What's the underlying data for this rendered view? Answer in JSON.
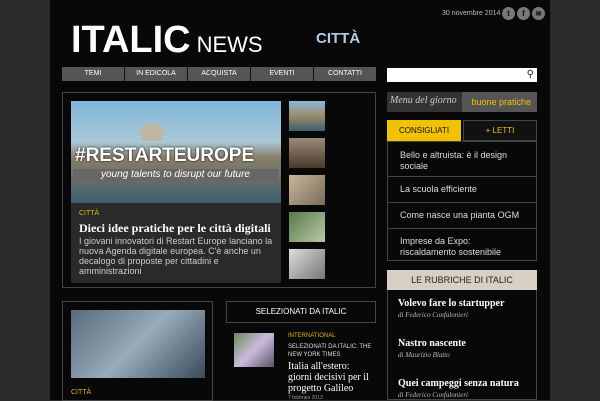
{
  "brand": {
    "main": "ITALIC",
    "sub": "NEWS",
    "section": "CITTÀ"
  },
  "header": {
    "date": "30 novembre 2014",
    "social": [
      "twitter-icon",
      "facebook-icon",
      "rss-icon"
    ]
  },
  "nav": [
    "TEMI",
    "IN EDICOLA",
    "ACQUISTA",
    "EVENTI",
    "CONTATTI"
  ],
  "search": {
    "placeholder": ""
  },
  "menu": {
    "label": "Menu del giorno",
    "selected": "buone pratiche"
  },
  "featured": {
    "overlay_title": "#RESTARTEUROPE",
    "overlay_sub": "young talents to disrupt our future",
    "category": "CITTÀ",
    "headline": "Dieci idee pratiche per le città digitali",
    "summary": "I giovani innovatori di Restart Europe lanciano la nuova Agenda digitale europea. C'è anche un decalogo di proposte per cittadini e amministrazioni"
  },
  "second": {
    "category": "CITTÀ"
  },
  "selected": {
    "header": "SELEZIONATI DA ITALIC",
    "category": "INTERNATIONAL",
    "source": "SELEZIONATI DA ITALIC: THE NEW YORK TIMES",
    "title": "Italia all'estero: giorni decisivi per il progetto Galileo",
    "date": "7 febbraio 2013"
  },
  "tabs": {
    "first": "CONSIGLIATI",
    "second": "+ LETTI"
  },
  "consigliati": [
    "Bello e altruista: è il design sociale",
    "La scuola efficiente",
    "Come nasce una pianta OGM",
    "Imprese da Expo: riscaldamento sostenibile"
  ],
  "rubriche": {
    "header": "LE RUBRICHE DI ITALIC",
    "items": [
      {
        "title": "Volevo fare lo startupper",
        "author": "di Federico Confalonieri"
      },
      {
        "title": "Nastro nascente",
        "author": "di Maurizio Blatto"
      },
      {
        "title": "Quei campeggi senza natura",
        "author": "di Federico Confalonieri"
      }
    ]
  },
  "colors": {
    "accent": "#f2c200",
    "city": "#b3cde6"
  }
}
